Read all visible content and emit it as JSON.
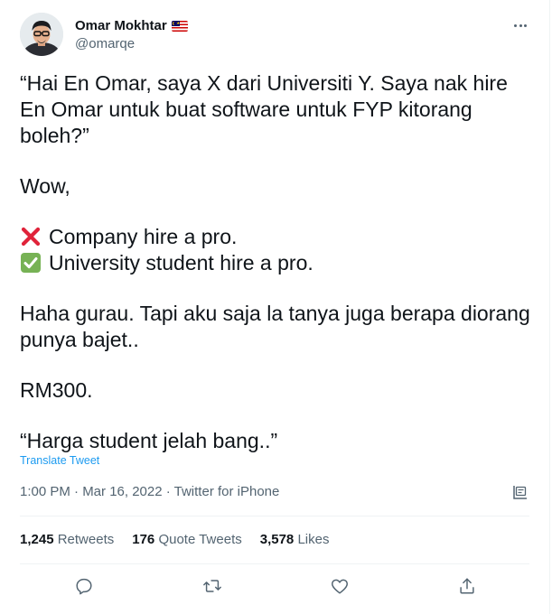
{
  "author": {
    "display_name": "Omar Mokhtar",
    "handle": "@omarqe",
    "flag_icon": "malaysia-flag-icon"
  },
  "tweet": {
    "lines": {
      "p1": "“Hai En Omar, saya X dari Universiti Y. Saya nak hire En Omar untuk buat software untuk FYP kitorang boleh?”",
      "p2": "Wow,",
      "p3a": "Company hire a pro.",
      "p3b": "University student hire a pro.",
      "p4": "Haha gurau. Tapi aku saja la tanya juga berapa diorang punya bajet..",
      "p5": "RM300.",
      "p6": "“Harga student jelah bang..”"
    },
    "emoji": {
      "cross": "cross-mark-emoji",
      "check": "check-mark-button-emoji"
    },
    "translate_label": "Translate Tweet",
    "meta": "1:00 PM · Mar 16, 2022 · Twitter for iPhone"
  },
  "stats": {
    "retweets_count": "1,245",
    "retweets_label": "Retweets",
    "quotes_count": "176",
    "quotes_label": "Quote Tweets",
    "likes_count": "3,578",
    "likes_label": "Likes"
  },
  "colors": {
    "text": "#0f1419",
    "secondary": "#536471",
    "link": "#1d9bf0",
    "divider": "#eff3f4",
    "cross_red": "#e0233a",
    "check_green": "#77b255"
  },
  "actions": [
    "reply-icon",
    "retweet-icon",
    "like-icon",
    "share-icon"
  ]
}
